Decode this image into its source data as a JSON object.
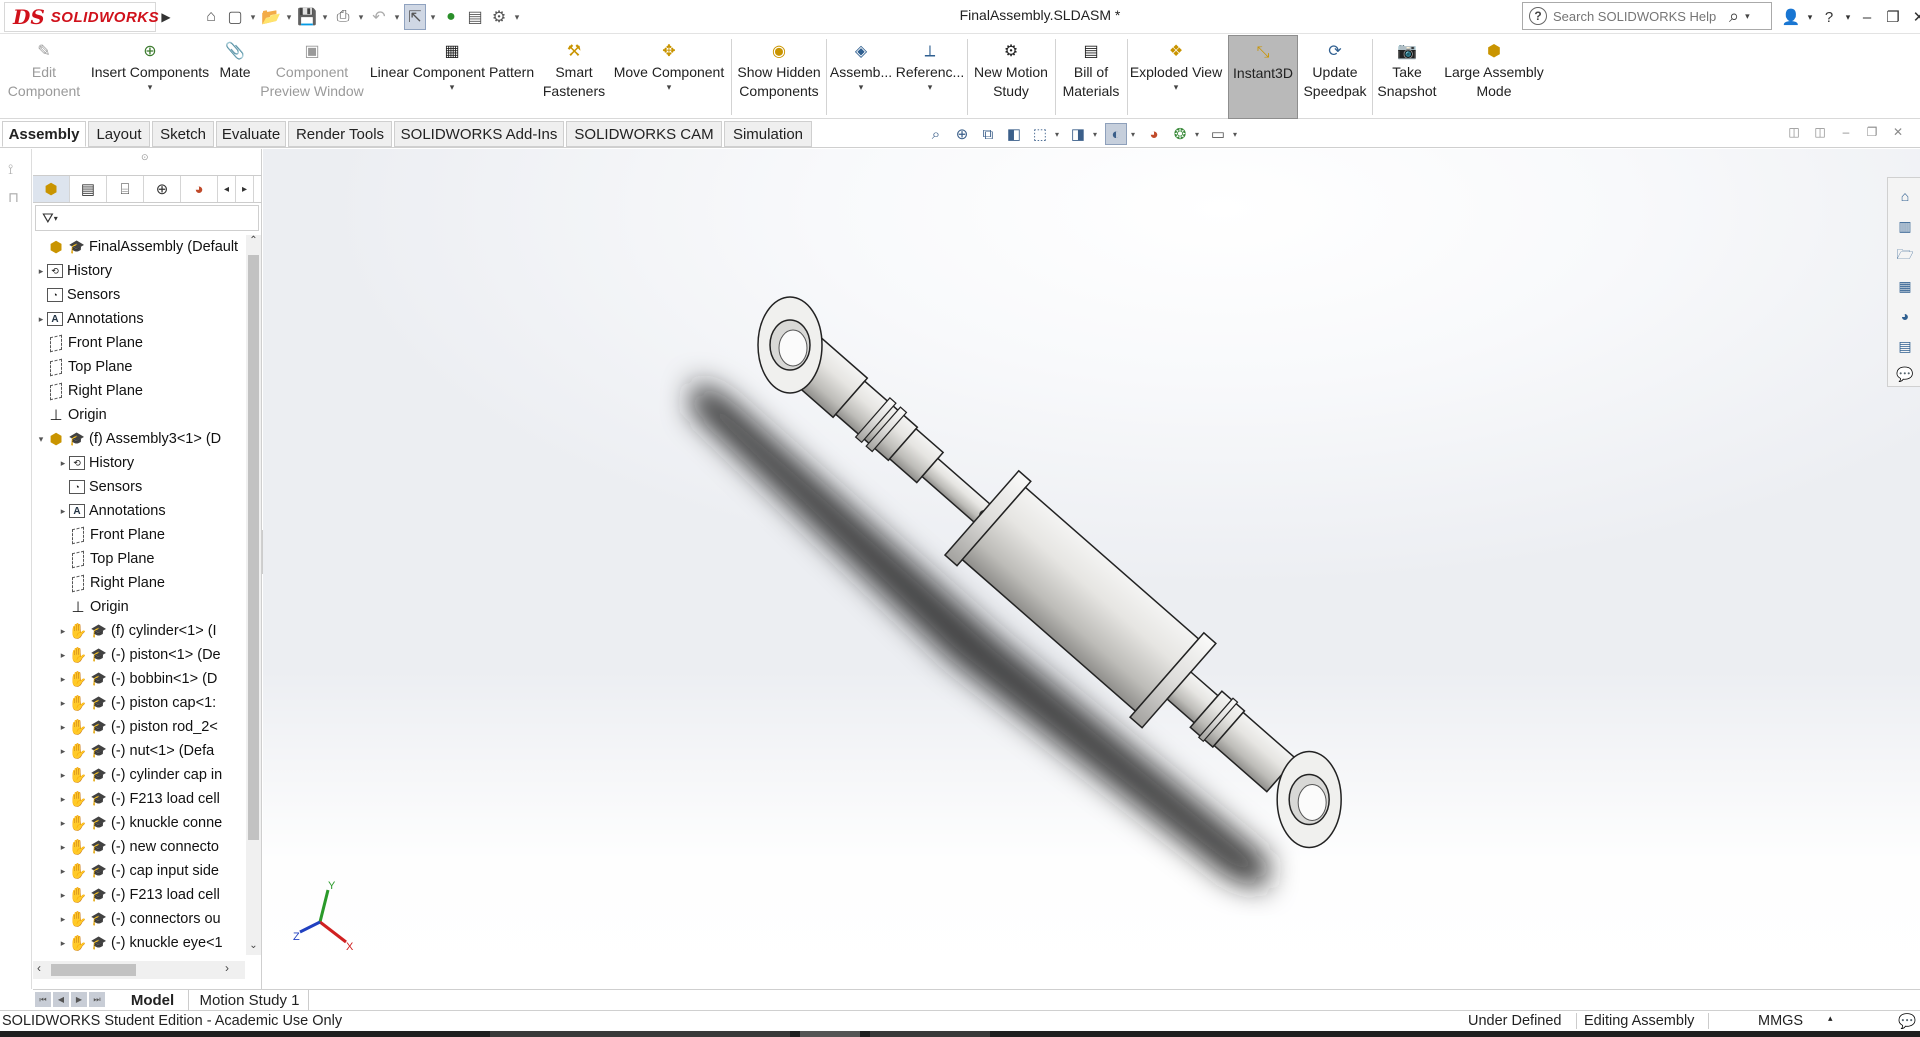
{
  "window": {
    "doc_title": "FinalAssembly.SLDASM *",
    "brand": "SOLIDWORKS",
    "brand_mark": "DS",
    "search_placeholder": "Search SOLIDWORKS Help"
  },
  "commands": [
    {
      "label": "Edit\nComponent",
      "icon": "edit-component-icon",
      "disabled": true
    },
    {
      "label": "Insert Components",
      "icon": "insert-components-icon",
      "dropdown": true
    },
    {
      "label": "Mate",
      "icon": "mate-icon"
    },
    {
      "label": "Component\nPreview Window",
      "icon": "preview-window-icon",
      "disabled": true
    },
    {
      "label": "Linear Component Pattern",
      "icon": "linear-pattern-icon",
      "dropdown": true
    },
    {
      "label": "Smart\nFasteners",
      "icon": "smart-fasteners-icon"
    },
    {
      "label": "Move Component",
      "icon": "move-component-icon",
      "dropdown": true
    },
    {
      "label": "Show Hidden\nComponents",
      "icon": "show-hidden-icon"
    },
    {
      "label": "Assemb...",
      "icon": "assembly-features-icon",
      "dropdown": true
    },
    {
      "label": "Referenc...",
      "icon": "reference-geometry-icon",
      "dropdown": true
    },
    {
      "label": "New Motion\nStudy",
      "icon": "motion-study-icon"
    },
    {
      "label": "Bill of\nMaterials",
      "icon": "bom-icon"
    },
    {
      "label": "Exploded View",
      "icon": "exploded-view-icon",
      "dropdown": true
    },
    {
      "label": "Instant3D",
      "icon": "instant3d-icon",
      "active": true
    },
    {
      "label": "Update\nSpeedpak",
      "icon": "speedpak-icon"
    },
    {
      "label": "Take\nSnapshot",
      "icon": "snapshot-icon"
    },
    {
      "label": "Large Assembly\nMode",
      "icon": "large-assembly-icon"
    }
  ],
  "tabs": [
    "Assembly",
    "Layout",
    "Sketch",
    "Evaluate",
    "Render Tools",
    "SOLIDWORKS Add-Ins",
    "SOLIDWORKS CAM",
    "Simulation"
  ],
  "selected_tab": "Assembly",
  "tree": [
    {
      "label": "FinalAssembly  (Default",
      "icon": "assembly",
      "level": 0,
      "toggle": ""
    },
    {
      "label": "History",
      "icon": "history",
      "level": 0,
      "toggle": "▸"
    },
    {
      "label": "Sensors",
      "icon": "sensors",
      "level": 0,
      "toggle": ""
    },
    {
      "label": "Annotations",
      "icon": "annotations",
      "level": 0,
      "toggle": "▸"
    },
    {
      "label": "Front Plane",
      "icon": "plane",
      "level": 0,
      "toggle": ""
    },
    {
      "label": "Top Plane",
      "icon": "plane",
      "level": 0,
      "toggle": ""
    },
    {
      "label": "Right Plane",
      "icon": "plane",
      "level": 0,
      "toggle": ""
    },
    {
      "label": "Origin",
      "icon": "origin",
      "level": 0,
      "toggle": ""
    },
    {
      "label": "(f) Assembly3<1> (D",
      "icon": "assembly",
      "level": 0,
      "toggle": "▾"
    },
    {
      "label": "History",
      "icon": "history",
      "level": 1,
      "toggle": "▸"
    },
    {
      "label": "Sensors",
      "icon": "sensors",
      "level": 1,
      "toggle": ""
    },
    {
      "label": "Annotations",
      "icon": "annotations",
      "level": 1,
      "toggle": "▸"
    },
    {
      "label": "Front Plane",
      "icon": "plane",
      "level": 1,
      "toggle": ""
    },
    {
      "label": "Top Plane",
      "icon": "plane",
      "level": 1,
      "toggle": ""
    },
    {
      "label": "Right Plane",
      "icon": "plane",
      "level": 1,
      "toggle": ""
    },
    {
      "label": "Origin",
      "icon": "origin",
      "level": 1,
      "toggle": ""
    },
    {
      "label": "(f) cylinder<1> (I",
      "icon": "part",
      "level": 1,
      "toggle": "▸"
    },
    {
      "label": "(-) piston<1> (De",
      "icon": "part",
      "level": 1,
      "toggle": "▸"
    },
    {
      "label": "(-) bobbin<1> (D",
      "icon": "part",
      "level": 1,
      "toggle": "▸"
    },
    {
      "label": "(-) piston cap<1:",
      "icon": "part",
      "level": 1,
      "toggle": "▸"
    },
    {
      "label": "(-) piston rod_2<",
      "icon": "part",
      "level": 1,
      "toggle": "▸"
    },
    {
      "label": "(-) nut<1> (Defa",
      "icon": "part",
      "level": 1,
      "toggle": "▸"
    },
    {
      "label": "(-) cylinder cap in",
      "icon": "part",
      "level": 1,
      "toggle": "▸"
    },
    {
      "label": "(-) F213 load cell",
      "icon": "part",
      "level": 1,
      "toggle": "▸"
    },
    {
      "label": "(-) knuckle conne",
      "icon": "part",
      "level": 1,
      "toggle": "▸"
    },
    {
      "label": "(-) new connecto",
      "icon": "part",
      "level": 1,
      "toggle": "▸"
    },
    {
      "label": "(-) cap input side",
      "icon": "part",
      "level": 1,
      "toggle": "▸"
    },
    {
      "label": "(-) F213 load cell",
      "icon": "part",
      "level": 1,
      "toggle": "▸"
    },
    {
      "label": "(-) connectors ou",
      "icon": "part",
      "level": 1,
      "toggle": "▸"
    },
    {
      "label": "(-) knuckle eye<1",
      "icon": "part",
      "level": 1,
      "toggle": "▸"
    }
  ],
  "bottom_tabs": [
    "Model",
    "Motion Study 1"
  ],
  "status": {
    "edition": "SOLIDWORKS Student Edition - Academic Use Only",
    "definition": "Under Defined",
    "mode": "Editing Assembly",
    "units": "MMGS"
  },
  "triad": {
    "x": "X",
    "y": "Y",
    "z": "Z"
  },
  "colors": {
    "brand_red": "#d0111b",
    "accent_blue": "#2f5f90",
    "part_yellow": "#d8a300"
  }
}
